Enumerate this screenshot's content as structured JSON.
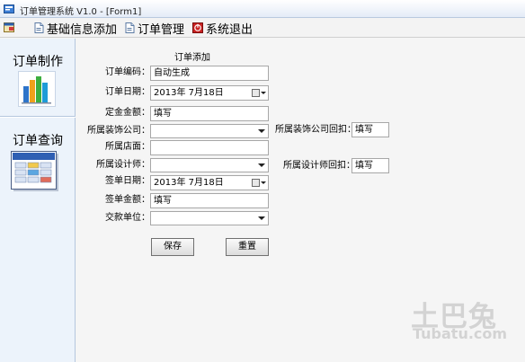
{
  "window": {
    "title": "订单管理系统 V1.0 - [Form1]"
  },
  "menu": {
    "items": [
      {
        "label": "基础信息添加",
        "icon": "document-icon"
      },
      {
        "label": "订单管理",
        "icon": "document-icon"
      },
      {
        "label": "系统退出",
        "icon": "exit-icon"
      }
    ]
  },
  "sidebar": {
    "sections": [
      {
        "label": "订单制作",
        "icon": "bar-chart-icon"
      },
      {
        "label": "订单查询",
        "icon": "spreadsheet-icon"
      }
    ]
  },
  "form": {
    "heading": "订单添加",
    "order_code": {
      "label": "订单编码：",
      "value": "自动生成"
    },
    "order_date": {
      "label": "订单日期：",
      "value": "2013年  7月18日"
    },
    "deposit": {
      "label": "定金金额：",
      "value": "填写"
    },
    "decor_company": {
      "label": "所属装饰公司：",
      "value": ""
    },
    "decor_company_rebate": {
      "label": "所属装饰公司回扣：",
      "value": "填写"
    },
    "store": {
      "label": "所属店面：",
      "value": ""
    },
    "designer": {
      "label": "所属设计师：",
      "value": ""
    },
    "designer_rebate": {
      "label": "所属设计师回扣：",
      "value": "填写"
    },
    "sign_date": {
      "label": "签单日期：",
      "value": "2013年  7月18日"
    },
    "sign_amount": {
      "label": "签单金额：",
      "value": "填写"
    },
    "payer": {
      "label": "交款单位：",
      "value": ""
    },
    "save_label": "保存",
    "reset_label": "重置"
  },
  "watermark": {
    "main": "土巴兔",
    "sub": "Tubatu.com"
  },
  "colors": {
    "sidebar_bg": "#ecf3fb",
    "titlebar_bg": "#e4ecf7",
    "form_bg": "#f5f5f5"
  }
}
